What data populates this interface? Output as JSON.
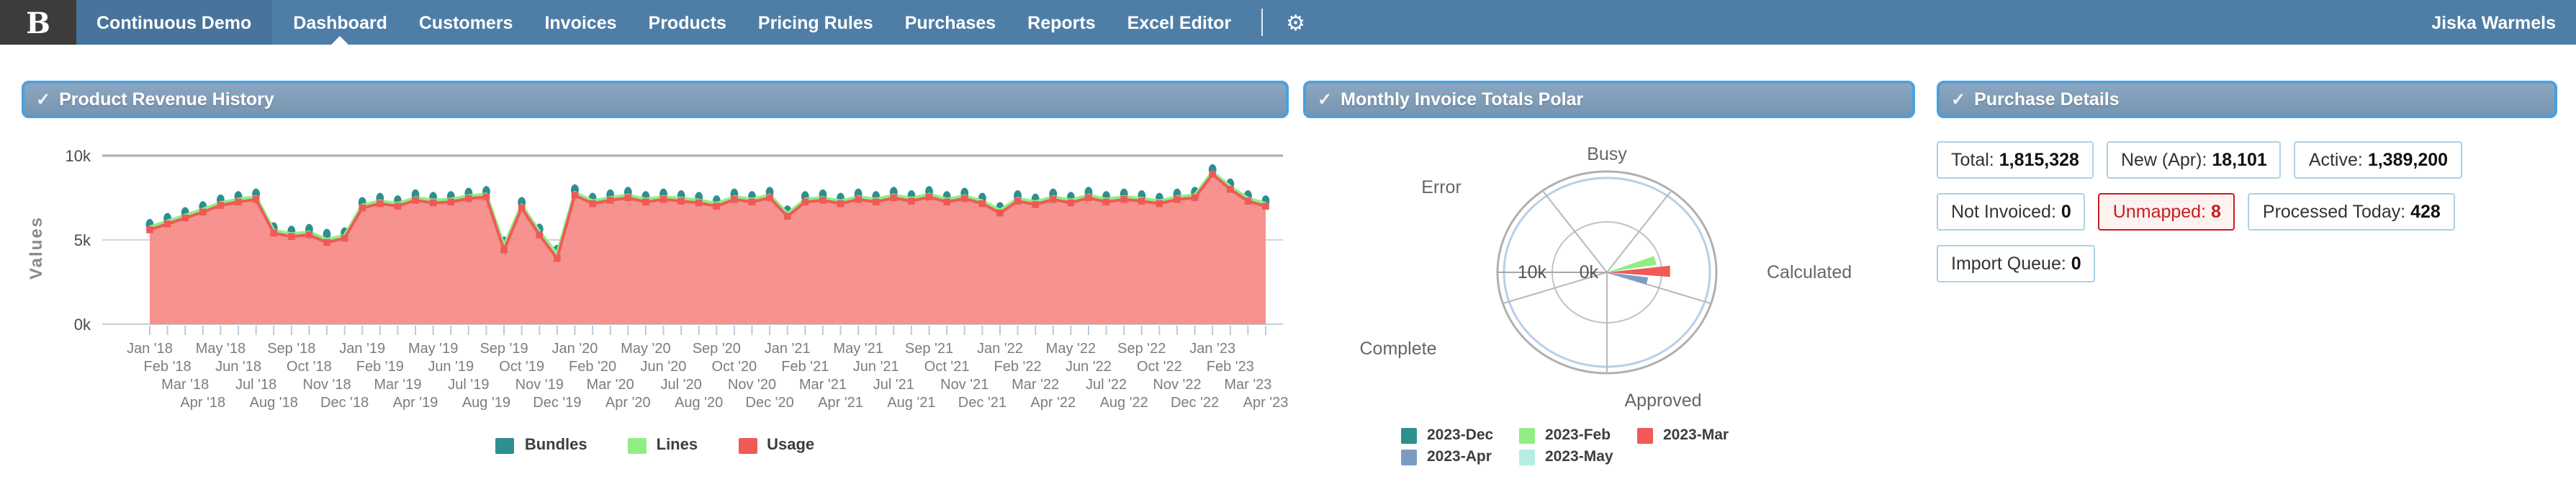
{
  "nav": {
    "logo_glyph": "B",
    "brand": "Continuous Demo",
    "items": [
      {
        "label": "Dashboard",
        "active": true
      },
      {
        "label": "Customers",
        "active": false
      },
      {
        "label": "Invoices",
        "active": false
      },
      {
        "label": "Products",
        "active": false
      },
      {
        "label": "Pricing Rules",
        "active": false
      },
      {
        "label": "Purchases",
        "active": false
      },
      {
        "label": "Reports",
        "active": false
      },
      {
        "label": "Excel Editor",
        "active": false
      }
    ],
    "gear_icon": "⚙",
    "user": "Jiska Warmels"
  },
  "panels": {
    "revenue": {
      "check": "✓",
      "title": "Product Revenue History"
    },
    "polar": {
      "check": "✓",
      "title": "Monthly Invoice Totals Polar"
    },
    "purchase": {
      "check": "✓",
      "title": "Purchase Details",
      "badges": [
        {
          "row": 0,
          "label": "Total:",
          "value": "1,815,328",
          "alert": false
        },
        {
          "row": 0,
          "label": "New (Apr):",
          "value": "18,101",
          "alert": false
        },
        {
          "row": 0,
          "label": "Active:",
          "value": "1,389,200",
          "alert": false
        },
        {
          "row": 1,
          "label": "Not Invoiced:",
          "value": "0",
          "alert": false
        },
        {
          "row": 1,
          "label": "Unmapped:",
          "value": "8",
          "alert": true
        },
        {
          "row": 1,
          "label": "Processed Today:",
          "value": "428",
          "alert": false
        },
        {
          "row": 2,
          "label": "Import Queue:",
          "value": "0",
          "alert": false
        }
      ]
    }
  },
  "chart_data": [
    {
      "type": "area",
      "title": "Product Revenue History",
      "ylabel": "Values",
      "ylim": [
        0,
        10000
      ],
      "yticks": [
        {
          "label": "0k",
          "value": 0
        },
        {
          "label": "5k",
          "value": 5000
        },
        {
          "label": "10k",
          "value": 10000
        }
      ],
      "x": [
        "Jan '18",
        "Feb '18",
        "Mar '18",
        "Apr '18",
        "May '18",
        "Jun '18",
        "Jul '18",
        "Aug '18",
        "Sep '18",
        "Oct '18",
        "Nov '18",
        "Dec '18",
        "Jan '19",
        "Feb '19",
        "Mar '19",
        "Apr '19",
        "May '19",
        "Jun '19",
        "Jul '19",
        "Aug '19",
        "Sep '19",
        "Oct '19",
        "Nov '19",
        "Dec '19",
        "Jan '20",
        "Feb '20",
        "Mar '20",
        "Apr '20",
        "May '20",
        "Jun '20",
        "Jul '20",
        "Aug '20",
        "Sep '20",
        "Oct '20",
        "Nov '20",
        "Dec '20",
        "Jan '21",
        "Feb '21",
        "Mar '21",
        "Apr '21",
        "May '21",
        "Jun '21",
        "Jul '21",
        "Aug '21",
        "Sep '21",
        "Oct '21",
        "Nov '21",
        "Dec '21",
        "Jan '22",
        "Feb '22",
        "Mar '22",
        "Apr '22",
        "May '22",
        "Jun '22",
        "Jul '22",
        "Aug '22",
        "Sep '22",
        "Oct '22",
        "Nov '22",
        "Dec '22",
        "Jan '23",
        "Feb '23",
        "Mar '23",
        "Apr '23"
      ],
      "series": [
        {
          "name": "Bundles",
          "color": "#2e8f8f",
          "marker": "ellipse",
          "values": [
            5920,
            6270,
            6620,
            6970,
            7370,
            7570,
            7720,
            5720,
            5520,
            5620,
            5330,
            5420,
            7220,
            7470,
            7320,
            7670,
            7520,
            7570,
            7770,
            7870,
            4880,
            7220,
            5640,
            4380,
            7970,
            7470,
            7670,
            7820,
            7570,
            7720,
            7620,
            7520,
            7320,
            7720,
            7570,
            7820,
            6720,
            7570,
            7670,
            7470,
            7720,
            7570,
            7820,
            7620,
            7870,
            7570,
            7770,
            7470,
            6920,
            7620,
            7420,
            7720,
            7520,
            7820,
            7570,
            7720,
            7620,
            7470,
            7720,
            7820,
            9160,
            8320,
            7620,
            7320
          ]
        },
        {
          "name": "Lines",
          "color": "#90ee85",
          "marker": "line",
          "values": [
            5750,
            6100,
            6450,
            6800,
            7200,
            7400,
            7550,
            5550,
            5350,
            5450,
            5020,
            5250,
            7050,
            7300,
            7150,
            7500,
            7350,
            7400,
            7600,
            7700,
            4650,
            7050,
            5470,
            4150,
            7800,
            7300,
            7500,
            7650,
            7400,
            7550,
            7450,
            7350,
            7150,
            7550,
            7400,
            7650,
            6550,
            7400,
            7500,
            7300,
            7550,
            7400,
            7650,
            7450,
            7700,
            7400,
            7600,
            7300,
            6750,
            7450,
            7250,
            7550,
            7350,
            7650,
            7400,
            7550,
            7450,
            7300,
            7550,
            7650,
            9020,
            8150,
            7450,
            7150
          ]
        },
        {
          "name": "Usage",
          "color": "#ef5a57",
          "marker": "square",
          "fill": "#f58b86",
          "values": [
            5600,
            5950,
            6300,
            6650,
            7050,
            7250,
            7400,
            5400,
            5200,
            5300,
            4850,
            5100,
            6900,
            7150,
            7000,
            7350,
            7200,
            7250,
            7450,
            7550,
            4400,
            6900,
            5300,
            3900,
            7650,
            7150,
            7350,
            7500,
            7250,
            7400,
            7300,
            7200,
            7000,
            7400,
            7250,
            7500,
            6400,
            7250,
            7350,
            7150,
            7400,
            7250,
            7500,
            7300,
            7550,
            7250,
            7450,
            7150,
            6600,
            7300,
            7100,
            7400,
            7200,
            7500,
            7250,
            7400,
            7300,
            7150,
            7400,
            7500,
            8900,
            8000,
            7300,
            7000
          ]
        }
      ],
      "legend_position": "bottom"
    },
    {
      "type": "polar",
      "title": "Monthly Invoice Totals Polar",
      "categories": [
        "Busy",
        "Calculated",
        "Approved",
        "Complete",
        "Error"
      ],
      "radial_ticks": [
        {
          "label": "0k",
          "value": 0
        },
        {
          "label": "10k",
          "value": 10000
        }
      ],
      "rmax": 20000,
      "series": [
        {
          "name": "2023-Dec",
          "color": "#2e8f8f",
          "category": "Calculated",
          "value": 0,
          "angle_deg": 29
        },
        {
          "name": "2023-Apr",
          "color": "#7b9dc4",
          "category": "Calculated",
          "value": 7600,
          "angle_deg": -13
        },
        {
          "name": "2023-Feb",
          "color": "#90ee85",
          "category": "Calculated",
          "value": 9200,
          "angle_deg": 15
        },
        {
          "name": "2023-May",
          "color": "#b5ede6",
          "category": "Calculated",
          "value": 0,
          "angle_deg": -27
        },
        {
          "name": "2023-Mar",
          "color": "#ef5a57",
          "category": "Calculated",
          "value": 11600,
          "angle_deg": 1
        }
      ],
      "legend_order": [
        "2023-Dec",
        "2023-Feb",
        "2023-Mar",
        "2023-Apr",
        "2023-May"
      ]
    }
  ]
}
